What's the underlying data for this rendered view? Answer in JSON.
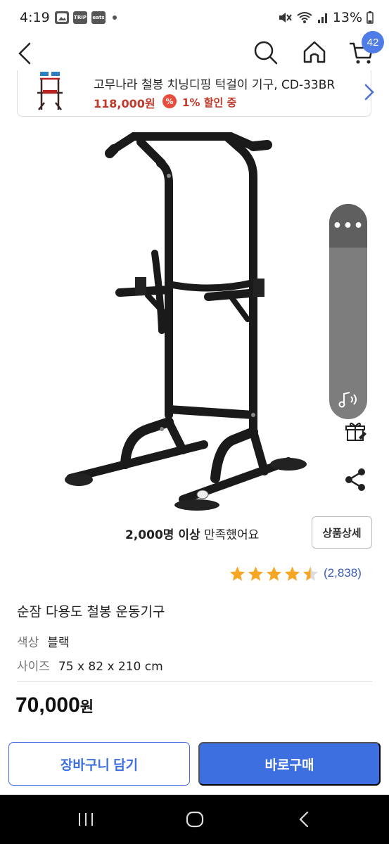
{
  "status_bar": {
    "time": "4:19",
    "notif_icons": [
      "gallery-icon",
      "trip-icon",
      "eats-icon"
    ],
    "trip_label": "TRIP",
    "eats_label": "eats",
    "battery": "13%"
  },
  "header": {
    "cart_count": "42"
  },
  "related_product": {
    "name": "고무나라 철봉 치닝디핑 턱걸이 기구, CD-33BR",
    "price": "118,000원",
    "discount_badge": "%",
    "discount": "1% 할인 중"
  },
  "floating_widget": {
    "menu": "•••"
  },
  "satisfaction": {
    "count": "2,000명 이상",
    "text": " 만족했어요"
  },
  "detail_button": "상품상세",
  "rating": {
    "stars": 4.5,
    "review_count": "(2,838)"
  },
  "product": {
    "title": "순잠 다용도 철봉 운동기구",
    "color_label": "색상",
    "color_value": "블랙",
    "size_label": "사이즈",
    "size_value": "75 x 82 x 210 cm",
    "price_number": "70,000",
    "price_unit": "원"
  },
  "actions": {
    "add_to_cart": "장바구니 담기",
    "buy_now": "바로구매"
  },
  "colors": {
    "accent": "#3d6fe0",
    "badge": "#4f7ce6",
    "price_red": "#c0392b",
    "star": "#f5a623"
  }
}
